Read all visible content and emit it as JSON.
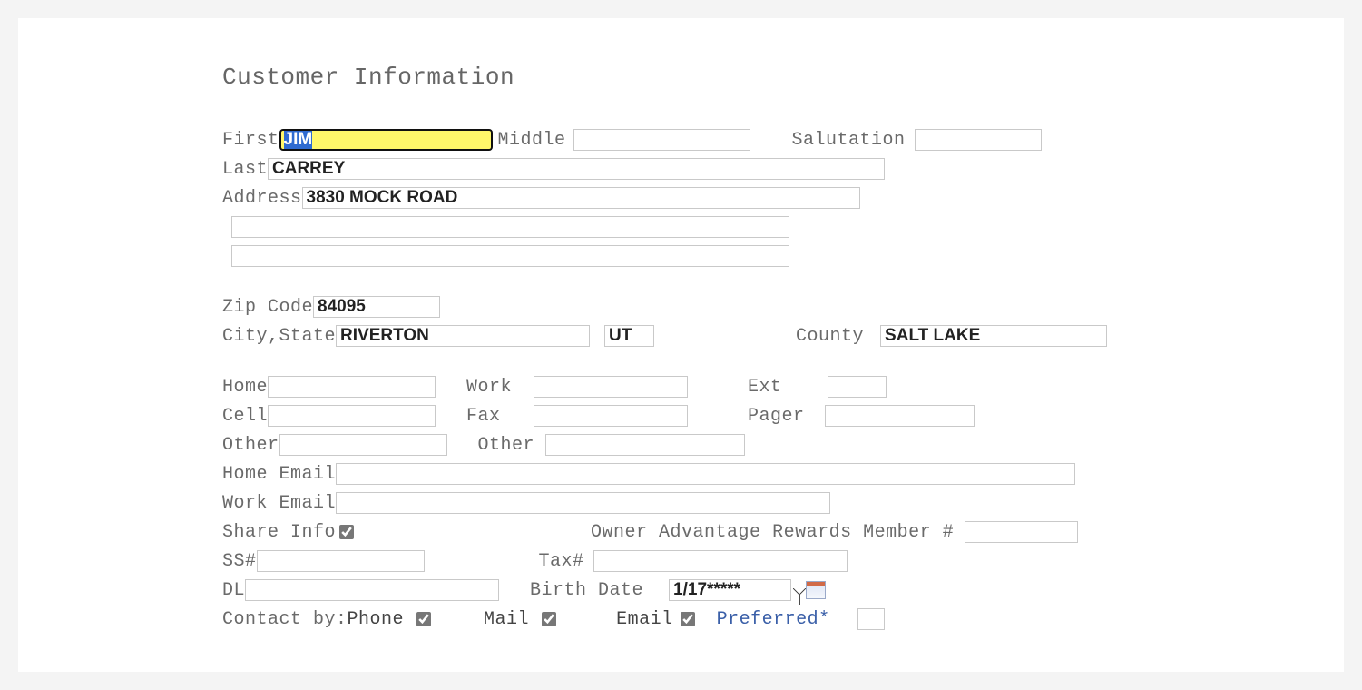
{
  "section_title": "Customer Information",
  "labels": {
    "first": "First",
    "middle": "Middle",
    "salutation": "Salutation",
    "last": "Last",
    "address": "Address",
    "zip": "Zip Code",
    "citystate": "City,State",
    "county": "County",
    "home": "Home",
    "work": "Work",
    "ext": "Ext",
    "cell": "Cell",
    "fax": "Fax",
    "pager": "Pager",
    "other1": "Other",
    "other2": "Other",
    "home_email": "Home Email",
    "work_email": "Work Email",
    "share_info": "Share Info",
    "oar": "Owner Advantage Rewards Member #",
    "ss": "SS#",
    "tax": "Tax#",
    "dl": "DL",
    "birth": "Birth Date",
    "contact_by": "Contact by:",
    "phone": "Phone",
    "mail": "Mail",
    "email": "Email",
    "preferred": "Preferred*"
  },
  "values": {
    "first": "JIM",
    "middle": "",
    "salutation": "",
    "last": "CARREY",
    "address1": "3830 MOCK ROAD",
    "address2": "",
    "address3": "",
    "zip": "84095",
    "city": "RIVERTON",
    "state": "UT",
    "county": "SALT LAKE",
    "home": "",
    "work": "",
    "ext": "",
    "cell": "",
    "fax": "",
    "pager": "",
    "other1": "",
    "other2": "",
    "home_email": "",
    "work_email": "",
    "oar": "",
    "ss": "",
    "tax": "",
    "dl": "",
    "birth": "1/17*****",
    "preferred": ""
  },
  "checks": {
    "share_info": true,
    "phone": true,
    "mail": true,
    "email": true
  }
}
